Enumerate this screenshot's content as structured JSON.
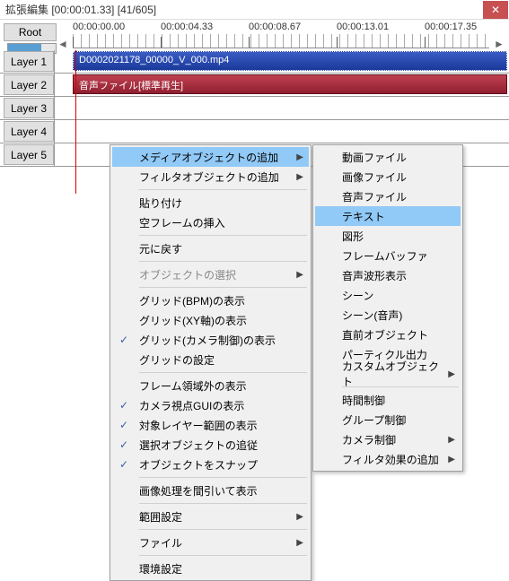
{
  "window": {
    "title": "拡張編集 [00:00:01.33] [41/605]"
  },
  "toolbar": {
    "root": "Root"
  },
  "ruler": {
    "labels": [
      "00:00:00.00",
      "00:00:04.33",
      "00:00:08.67",
      "00:00:13.01",
      "00:00:17.35"
    ]
  },
  "layers": [
    "Layer 1",
    "Layer 2",
    "Layer 3",
    "Layer 4",
    "Layer 5"
  ],
  "clips": {
    "video": "D0002021178_00000_V_000.mp4",
    "audio": "音声ファイル[標準再生]"
  },
  "menu1": {
    "media_add": "メディアオブジェクトの追加",
    "filter_add": "フィルタオブジェクトの追加",
    "paste": "貼り付け",
    "empty_frame": "空フレームの挿入",
    "undo": "元に戻す",
    "select_obj": "オブジェクトの選択",
    "grid_bpm": "グリッド(BPM)の表示",
    "grid_xy": "グリッド(XY軸)の表示",
    "grid_cam": "グリッド(カメラ制御)の表示",
    "grid_settings": "グリッドの設定",
    "frame_out": "フレーム領域外の表示",
    "cam_gui": "カメラ視点GUIの表示",
    "target_layer": "対象レイヤー範囲の表示",
    "follow_sel": "選択オブジェクトの追従",
    "snap_obj": "オブジェクトをスナップ",
    "image_thin": "画像処理を間引いて表示",
    "range": "範囲設定",
    "file": "ファイル",
    "env": "環境設定"
  },
  "menu2": {
    "video": "動画ファイル",
    "image": "画像ファイル",
    "audio": "音声ファイル",
    "text": "テキスト",
    "shape": "図形",
    "framebuf": "フレームバッファ",
    "waveform": "音声波形表示",
    "scene": "シーン",
    "scene_audio": "シーン(音声)",
    "prev_obj": "直前オブジェクト",
    "particle": "パーティクル出力",
    "custom": "カスタムオブジェクト",
    "time_ctrl": "時間制御",
    "group_ctrl": "グループ制御",
    "cam_ctrl": "カメラ制御",
    "filter_fx": "フィルタ効果の追加"
  }
}
